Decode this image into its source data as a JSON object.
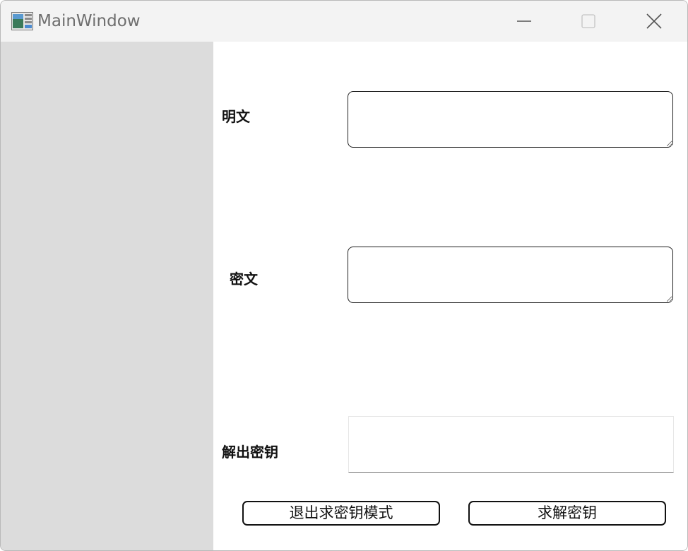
{
  "window": {
    "title": "MainWindow",
    "icons": {
      "app": "app-window-icon",
      "minimize": "minimize-icon",
      "maximize": "maximize-icon",
      "close": "close-icon"
    }
  },
  "form": {
    "plaintext_label": "明文",
    "plaintext_value": "",
    "ciphertext_label": "密文",
    "ciphertext_value": "",
    "key_label": "解出密钥",
    "key_value": ""
  },
  "buttons": {
    "exit_label": "退出求密钥模式",
    "solve_label": "求解密钥"
  },
  "colors": {
    "titlebar": "#f3f3f3",
    "sidebar": "#dcdcdc",
    "content": "#ffffff",
    "border": "#1e1e1e"
  }
}
